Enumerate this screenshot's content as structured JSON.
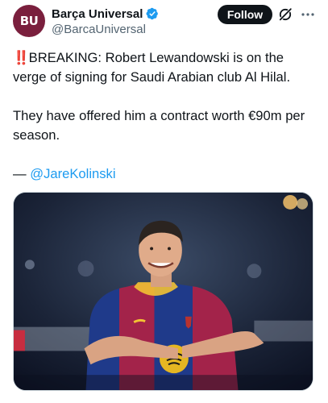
{
  "account": {
    "avatar_text": "BU",
    "display_name": "Barça Universal",
    "handle": "@BarcaUniversal",
    "verified_icon": "verified-badge-icon",
    "avatar_color": "#7a1f3d",
    "verified_color": "#1d9bf0"
  },
  "actions": {
    "follow_label": "Follow",
    "grok_icon": "grok-icon",
    "more_icon": "more-icon"
  },
  "post": {
    "alert_glyph": "‼️",
    "line1": "BREAKING: Robert Lewandowski is on the verge of signing for Saudi Arabian club Al Hilal.",
    "line2": "They have offered him a contract worth €90m per season.",
    "attribution_prefix": "— ",
    "attribution_mention": "@JareKolinski",
    "mention_color": "#1d9bf0"
  },
  "media": {
    "icon": "player-photo"
  }
}
